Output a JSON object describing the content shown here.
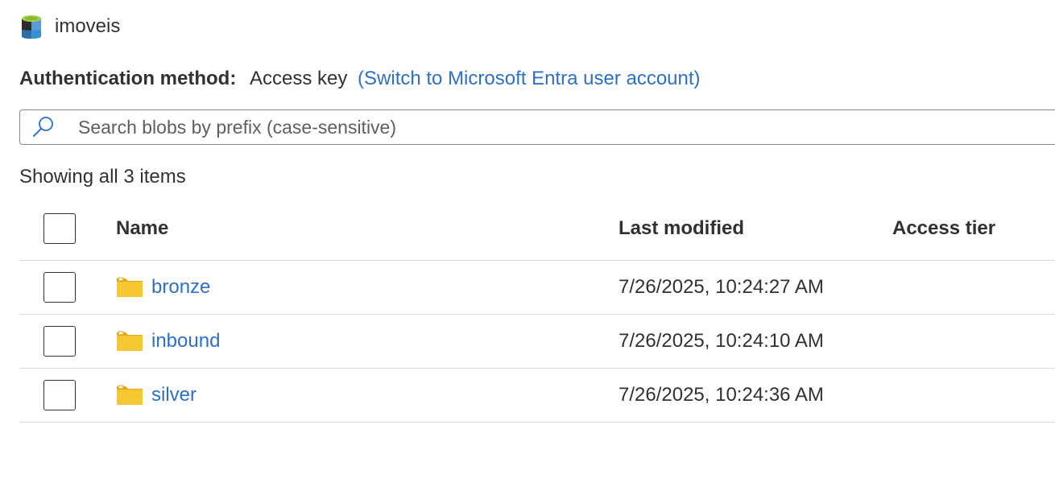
{
  "header": {
    "title": "imoveis",
    "icon": "storage-container-icon"
  },
  "auth": {
    "label": "Authentication method:",
    "value": "Access key",
    "switch_link": "(Switch to Microsoft Entra user account)"
  },
  "search": {
    "placeholder": "Search blobs by prefix (case-sensitive)",
    "value": "",
    "icon": "search-icon"
  },
  "items_count": "Showing all 3 items",
  "table": {
    "columns": [
      "Name",
      "Last modified",
      "Access tier"
    ],
    "rows": [
      {
        "name": "bronze",
        "last_modified": "7/26/2025, 10:24:27 AM",
        "access_tier": "",
        "icon": "folder-icon"
      },
      {
        "name": "inbound",
        "last_modified": "7/26/2025, 10:24:10 AM",
        "access_tier": "",
        "icon": "folder-icon"
      },
      {
        "name": "silver",
        "last_modified": "7/26/2025, 10:24:36 AM",
        "access_tier": "",
        "icon": "folder-icon"
      }
    ]
  },
  "colors": {
    "link": "#2f6fc4",
    "text": "#323130",
    "folder": "#f2c12e",
    "border": "#8a8886",
    "divider": "#e1dfdd"
  }
}
